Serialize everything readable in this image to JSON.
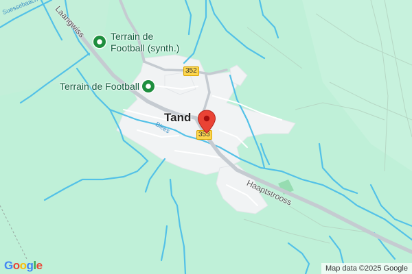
{
  "map": {
    "town": "Tand",
    "pois": [
      {
        "line1": "Terrain de",
        "line2": "Football (synth.)"
      },
      {
        "line1": "Terrain de Football"
      }
    ],
    "roads": {
      "route_352": "352",
      "route_353": "353",
      "laangwiss": "Laangwiss",
      "haaptstrooss": "Haaptstrooss"
    },
    "waterways": {
      "suessebaach": "Suessebaach",
      "blees": "Blees"
    },
    "logo": "Google",
    "attribution": "Map data ©2025 Google",
    "colors": {
      "land": "#bff0d8",
      "water": "#53c1e7",
      "built_up": "#f1f3f4",
      "road": "#c9ced3",
      "poi": "#1e8e3e",
      "pin": "#ea4335"
    },
    "logo_colors": [
      "#4285f4",
      "#ea4335",
      "#fbbc05",
      "#4285f4",
      "#34a853",
      "#ea4335"
    ]
  }
}
